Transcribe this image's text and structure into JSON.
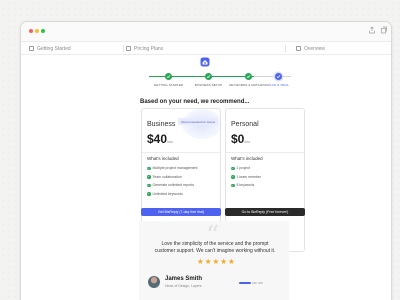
{
  "tabs": [
    {
      "label": "Getting Started"
    },
    {
      "label": "Pricing Plans"
    },
    {
      "label": "Overview"
    }
  ],
  "steps": [
    {
      "label": "Getting Started",
      "state": "done"
    },
    {
      "label": "Business Setup",
      "state": "done"
    },
    {
      "label": "Keywords & Matching",
      "state": "done"
    },
    {
      "label": "Plan & Trial",
      "state": "current"
    }
  ],
  "heading": "Based on your need, we recommend...",
  "plans": {
    "business": {
      "name": "Business",
      "price": "$40",
      "period": "/mo",
      "badge": "Recommended for teams",
      "included_label": "What's included",
      "features": [
        "Multiple project management",
        "Team collaboration",
        "Generate unlimited reports",
        "Unlimited keywords"
      ],
      "cta": "Get BizReply (7-day free trial)"
    },
    "personal": {
      "name": "Personal",
      "price": "$0",
      "period": "/mo",
      "included_label": "What's included",
      "features": [
        "1 project",
        "1 team member",
        "5 keywords"
      ],
      "cta": "Go to BizReply (Free forever!)"
    }
  },
  "testimonial": {
    "quote_mark": "“",
    "text": "Love the simplicity of the service and the prompt customer support. We can't imagine working without it.",
    "rating": 5,
    "star_glyph": "★",
    "name": "James Smith",
    "role": "Head of Design, Layers"
  },
  "colors": {
    "accent": "#4d63f0",
    "success": "#22a653",
    "star": "#f6a723",
    "dark_button": "#2a2a2a"
  },
  "icons": [
    "app-logo-icon",
    "share-icon",
    "copy-icon",
    "check-icon",
    "star-icon",
    "page-icon"
  ]
}
